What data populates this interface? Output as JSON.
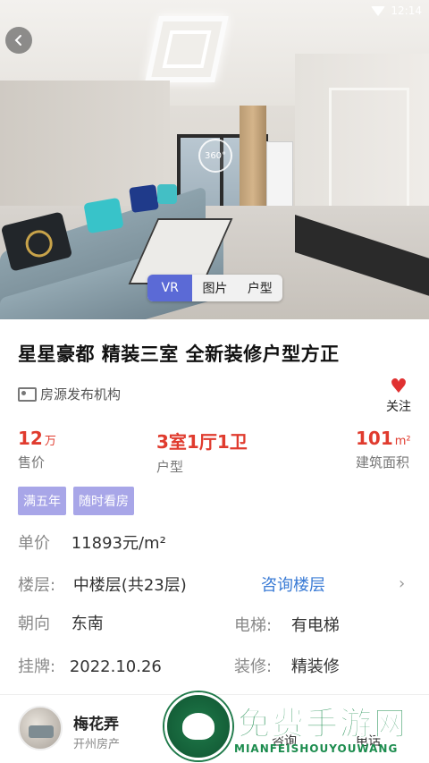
{
  "status_bar": {
    "time": "12:14"
  },
  "hero": {
    "vr_badge": "360°",
    "media_tabs": [
      {
        "label": "VR",
        "active": true
      },
      {
        "label": "图片",
        "active": false
      },
      {
        "label": "户型",
        "active": false
      }
    ]
  },
  "listing": {
    "title": "星星豪都 精装三室 全新装修户型方正",
    "agency": "房源发布机构",
    "follow_label": "关注",
    "stats": {
      "price": {
        "value": "12",
        "unit": "万",
        "label": "售价"
      },
      "layout": {
        "value": "3室1厅1卫",
        "label": "户型"
      },
      "area": {
        "value": "101",
        "unit": "m²",
        "label": "建筑面积"
      }
    },
    "tags": [
      "满五年",
      "随时看房"
    ],
    "unit_price": {
      "label": "单价",
      "value": "11893元/m²"
    },
    "floor": {
      "label": "楼层:",
      "value": "中楼层(共23层)",
      "action": "咨询楼层"
    },
    "orientation": {
      "label": "朝向",
      "value": "东南"
    },
    "elevator": {
      "label": "电梯:",
      "value": "有电梯"
    },
    "listed": {
      "label": "挂牌:",
      "value": "2022.10.26"
    },
    "decoration": {
      "label": "装修:",
      "value": "精装修"
    }
  },
  "agent_bar": {
    "name": "梅花弄",
    "company": "开州房产",
    "consult_label": "咨询",
    "call_label": "电话"
  },
  "watermark": {
    "text": "免费手游网",
    "sub": "MIANFEISHOUYOUWANG"
  },
  "colors": {
    "accent_red": "#e03b2e",
    "tab_active": "#5b6ad6",
    "tag_bg": "#a8a6e8",
    "link_blue": "#3a7bd5"
  }
}
